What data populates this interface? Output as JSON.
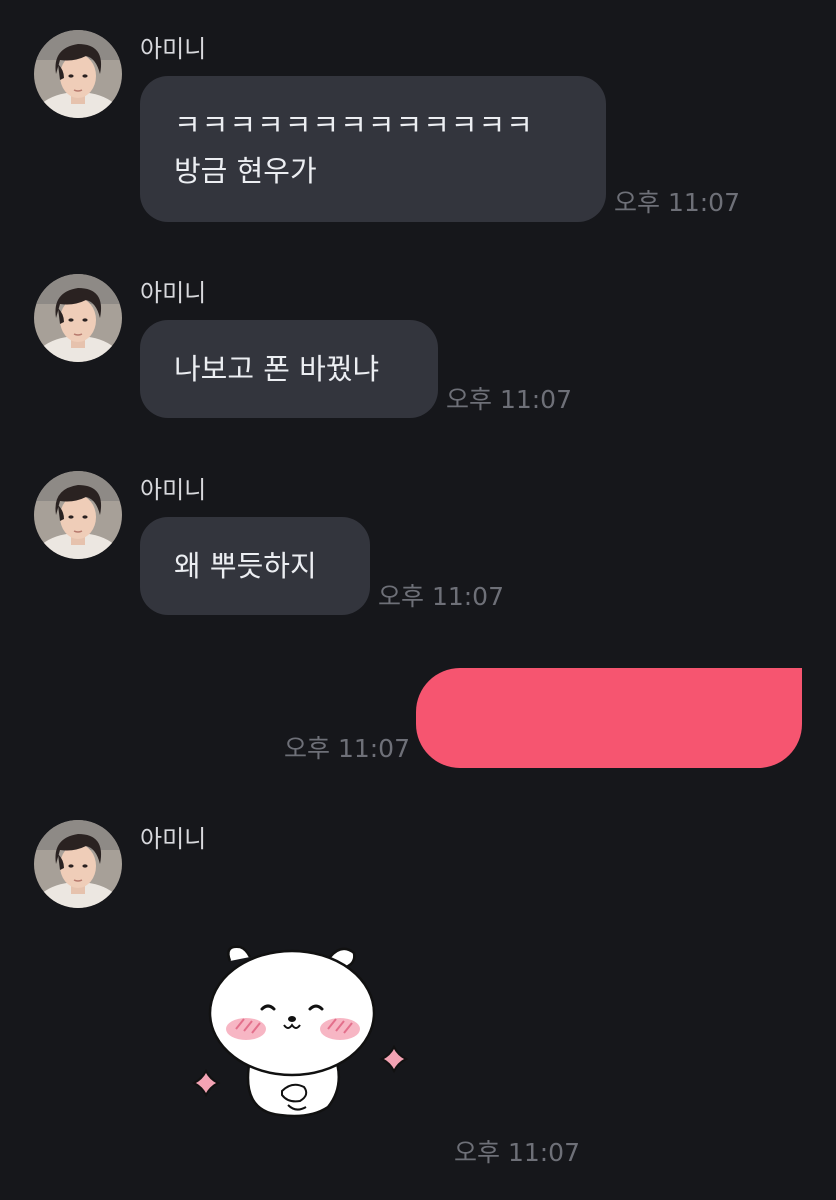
{
  "colors": {
    "background": "#16171b",
    "incoming_bubble": "#33353d",
    "outgoing_bubble": "#f65570",
    "timestamp": "#6e7078"
  },
  "messages": [
    {
      "sender": "아미니",
      "lines": [
        "ㅋㅋㅋㅋㅋㅋㅋㅋㅋㅋㅋㅋㅋ",
        "방금 현우가"
      ],
      "time": "오후 11:07"
    },
    {
      "sender": "아미니",
      "lines": [
        "나보고 폰 바꿨냐"
      ],
      "time": "오후 11:07"
    },
    {
      "sender": "아미니",
      "lines": [
        "왜 뿌듯하지"
      ],
      "time": "오후 11:07"
    },
    {
      "direction": "outgoing",
      "lines": [
        ""
      ],
      "time": "오후 11:07"
    },
    {
      "sender": "아미니",
      "sticker": "blushing-white-bear-sticker",
      "time": "오후 11:07"
    }
  ]
}
